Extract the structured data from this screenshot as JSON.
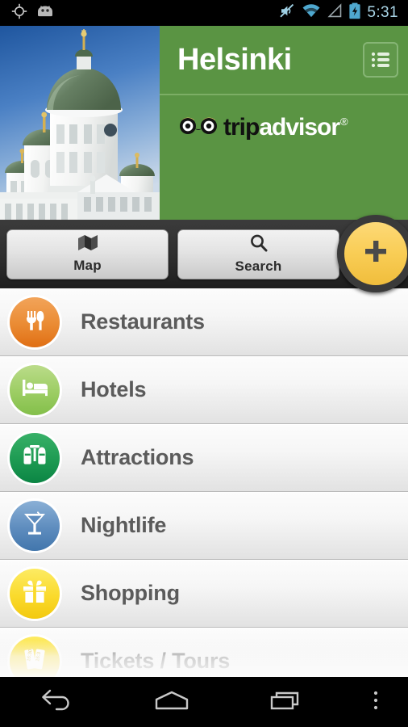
{
  "statusbar": {
    "time": "5:31",
    "icons": [
      "gps-crosshair-icon",
      "android-robot-icon",
      "volume-mute-icon",
      "wifi-icon",
      "cell-signal-icon",
      "battery-charging-icon"
    ]
  },
  "header": {
    "city_title": "Helsinki",
    "hero_image_alt": "helsinki-cathedral-photo",
    "menu_icon": "list-menu-icon",
    "brand": {
      "name_part_1": "trip",
      "name_part_2": "advisor",
      "trademark": "®",
      "owl_icon": "tripadvisor-owl-icon"
    },
    "accent_green": "#5a9443",
    "divider_green": "#7cae65"
  },
  "toolbar": {
    "buttons": [
      {
        "label": "Map",
        "icon": "folded-map-icon"
      },
      {
        "label": "Search",
        "icon": "magnifier-icon"
      }
    ],
    "fab": {
      "icon": "plus-icon",
      "label": "+",
      "color": "#f9cd55"
    }
  },
  "list": {
    "items": [
      {
        "label": "Restaurants",
        "icon": "fork-knife-icon",
        "color_top": "#f2a45a",
        "color_bottom": "#e87722"
      },
      {
        "label": "Hotels",
        "icon": "bed-icon",
        "color_top": "#b4d77f",
        "color_bottom": "#8cc152"
      },
      {
        "label": "Attractions",
        "icon": "binoculars-icon",
        "color_top": "#33a85f",
        "color_bottom": "#0f8c4a"
      },
      {
        "label": "Nightlife",
        "icon": "martini-icon",
        "color_top": "#7ba6cf",
        "color_bottom": "#4a7fb0"
      },
      {
        "label": "Shopping",
        "icon": "gift-icon",
        "color_top": "#fde95e",
        "color_bottom": "#f4cf1c"
      },
      {
        "label": "Tickets / Tours",
        "icon": "tickets-icon",
        "color_top": "#fde95e",
        "color_bottom": "#f4cf1c"
      }
    ]
  },
  "navbar": {
    "buttons": [
      {
        "name": "back",
        "icon": "back-arrow-icon"
      },
      {
        "name": "home",
        "icon": "home-icon"
      },
      {
        "name": "recents",
        "icon": "recent-apps-icon"
      },
      {
        "name": "overflow",
        "icon": "overflow-dots-icon"
      }
    ]
  }
}
